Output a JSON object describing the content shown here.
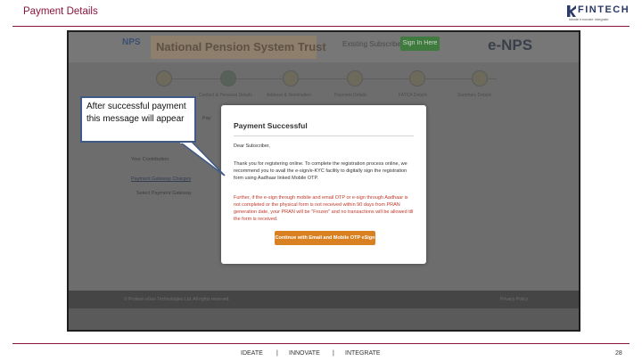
{
  "slide": {
    "title": "Payment Details",
    "page_number": "28",
    "slogan": [
      "IDEATE",
      "|",
      "INNOVATE",
      "|",
      "INTEGRATE"
    ]
  },
  "logo": {
    "name": "FINTECH",
    "tagline": "Ideate Innovate Integrate"
  },
  "callout": {
    "text": "After successful payment this message will appear"
  },
  "site": {
    "nps_logo": "NPS",
    "title": "National Pension System Trust",
    "existing_subscriber": "Existing Subscriber",
    "signin_label": "Sign In Here",
    "brand": "e-NPS",
    "steps": [
      "Contact & Personal Details",
      "Address & Nomination",
      "Payment Details",
      "FATCA Details",
      "Summary Details"
    ],
    "left_items": [
      "Pay",
      "Your Contribution",
      "Payment Gateway Charges",
      "Select Payment Gateway"
    ],
    "footer_left": "© Protean eGov Technologies Ltd. All rights reserved.",
    "footer_right": "Privacy Policy"
  },
  "modal": {
    "title": "Payment Successful",
    "greeting": "Dear Subscriber,",
    "body": "Thank you for registering online. To complete the registration process online, we recommend you to avail the e-sign/e-KYC facility to digitally sign the registration form using Aadhaar linked Mobile OTP.",
    "warning": "Further, if the e-sign through mobile and email OTP or e-sign through Aadhaar is not completed or the physical form is not received within 90 days from PRAN generation date, your PRAN will be \"Frozen\" and no transactions will be allowed till the form is received.",
    "button": "Continue with Email and Mobile OTP eSign"
  },
  "colors": {
    "accent": "#8a1640",
    "callout_border": "#3f5a86",
    "modal_button": "#d98021",
    "warning_text": "#c0392b"
  }
}
